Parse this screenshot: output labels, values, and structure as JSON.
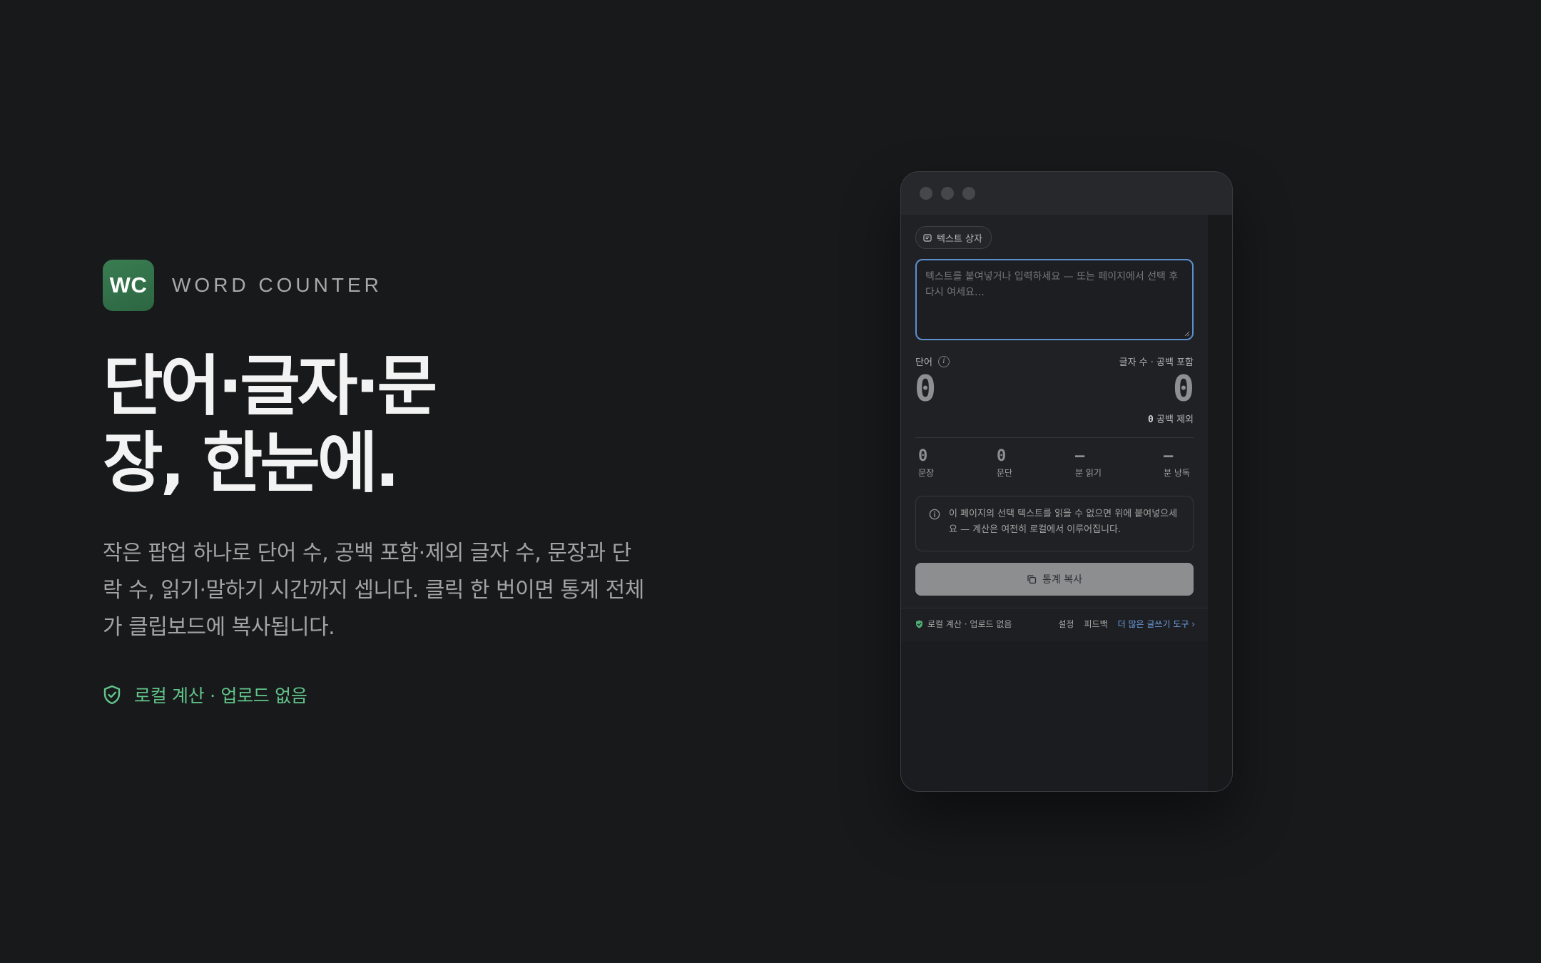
{
  "brand": {
    "logo_text": "WC",
    "name": "WORD COUNTER",
    "accent": "#2f6b45"
  },
  "hero": {
    "headline_line1": "단어·글자·문",
    "headline_line2": "장, 한눈에.",
    "description": "작은 팝업 하나로 단어 수, 공백 포함·제외 글자 수, 문장과 단락 수, 읽기·말하기 시간까지 셉니다. 클릭 한 번이면 통계 전체가 클립보드에 복사됩니다.",
    "privacy_text": "로컬 계산 · 업로드 없음",
    "privacy_color": "#62c58a"
  },
  "popup": {
    "chip_label": "텍스트 상자",
    "textarea_placeholder": "텍스트를 붙여넣거나 입력하세요 — 또는 페이지에서 선택 후 다시 여세요…",
    "words_label": "단어",
    "info_glyph": "i",
    "chars_label": "글자 수 · 공백 포함",
    "words_value": "0",
    "chars_value": "0",
    "chars_no_space_value": "0",
    "chars_no_space_label": "공백 제외",
    "stats": [
      {
        "value": "0",
        "label": "문장"
      },
      {
        "value": "0",
        "label": "문단"
      },
      {
        "value": "—",
        "label": "분 읽기"
      },
      {
        "value": "—",
        "label": "분 낭독"
      }
    ],
    "notice_text": "이 페이지의 선택 텍스트를 읽을 수 없으면 위에 붙여넣으세요 — 계산은 여전히 로컬에서 이루어집니다.",
    "copy_button_label": "통계 복사",
    "footer": {
      "privacy": "로컬 계산 · 업로드 없음",
      "settings": "설정",
      "feedback": "피드백",
      "more_tools": "더 많은 글쓰기 도구 ›"
    },
    "focus_color": "#5d8fd0",
    "link_color": "#6fa1e6"
  }
}
